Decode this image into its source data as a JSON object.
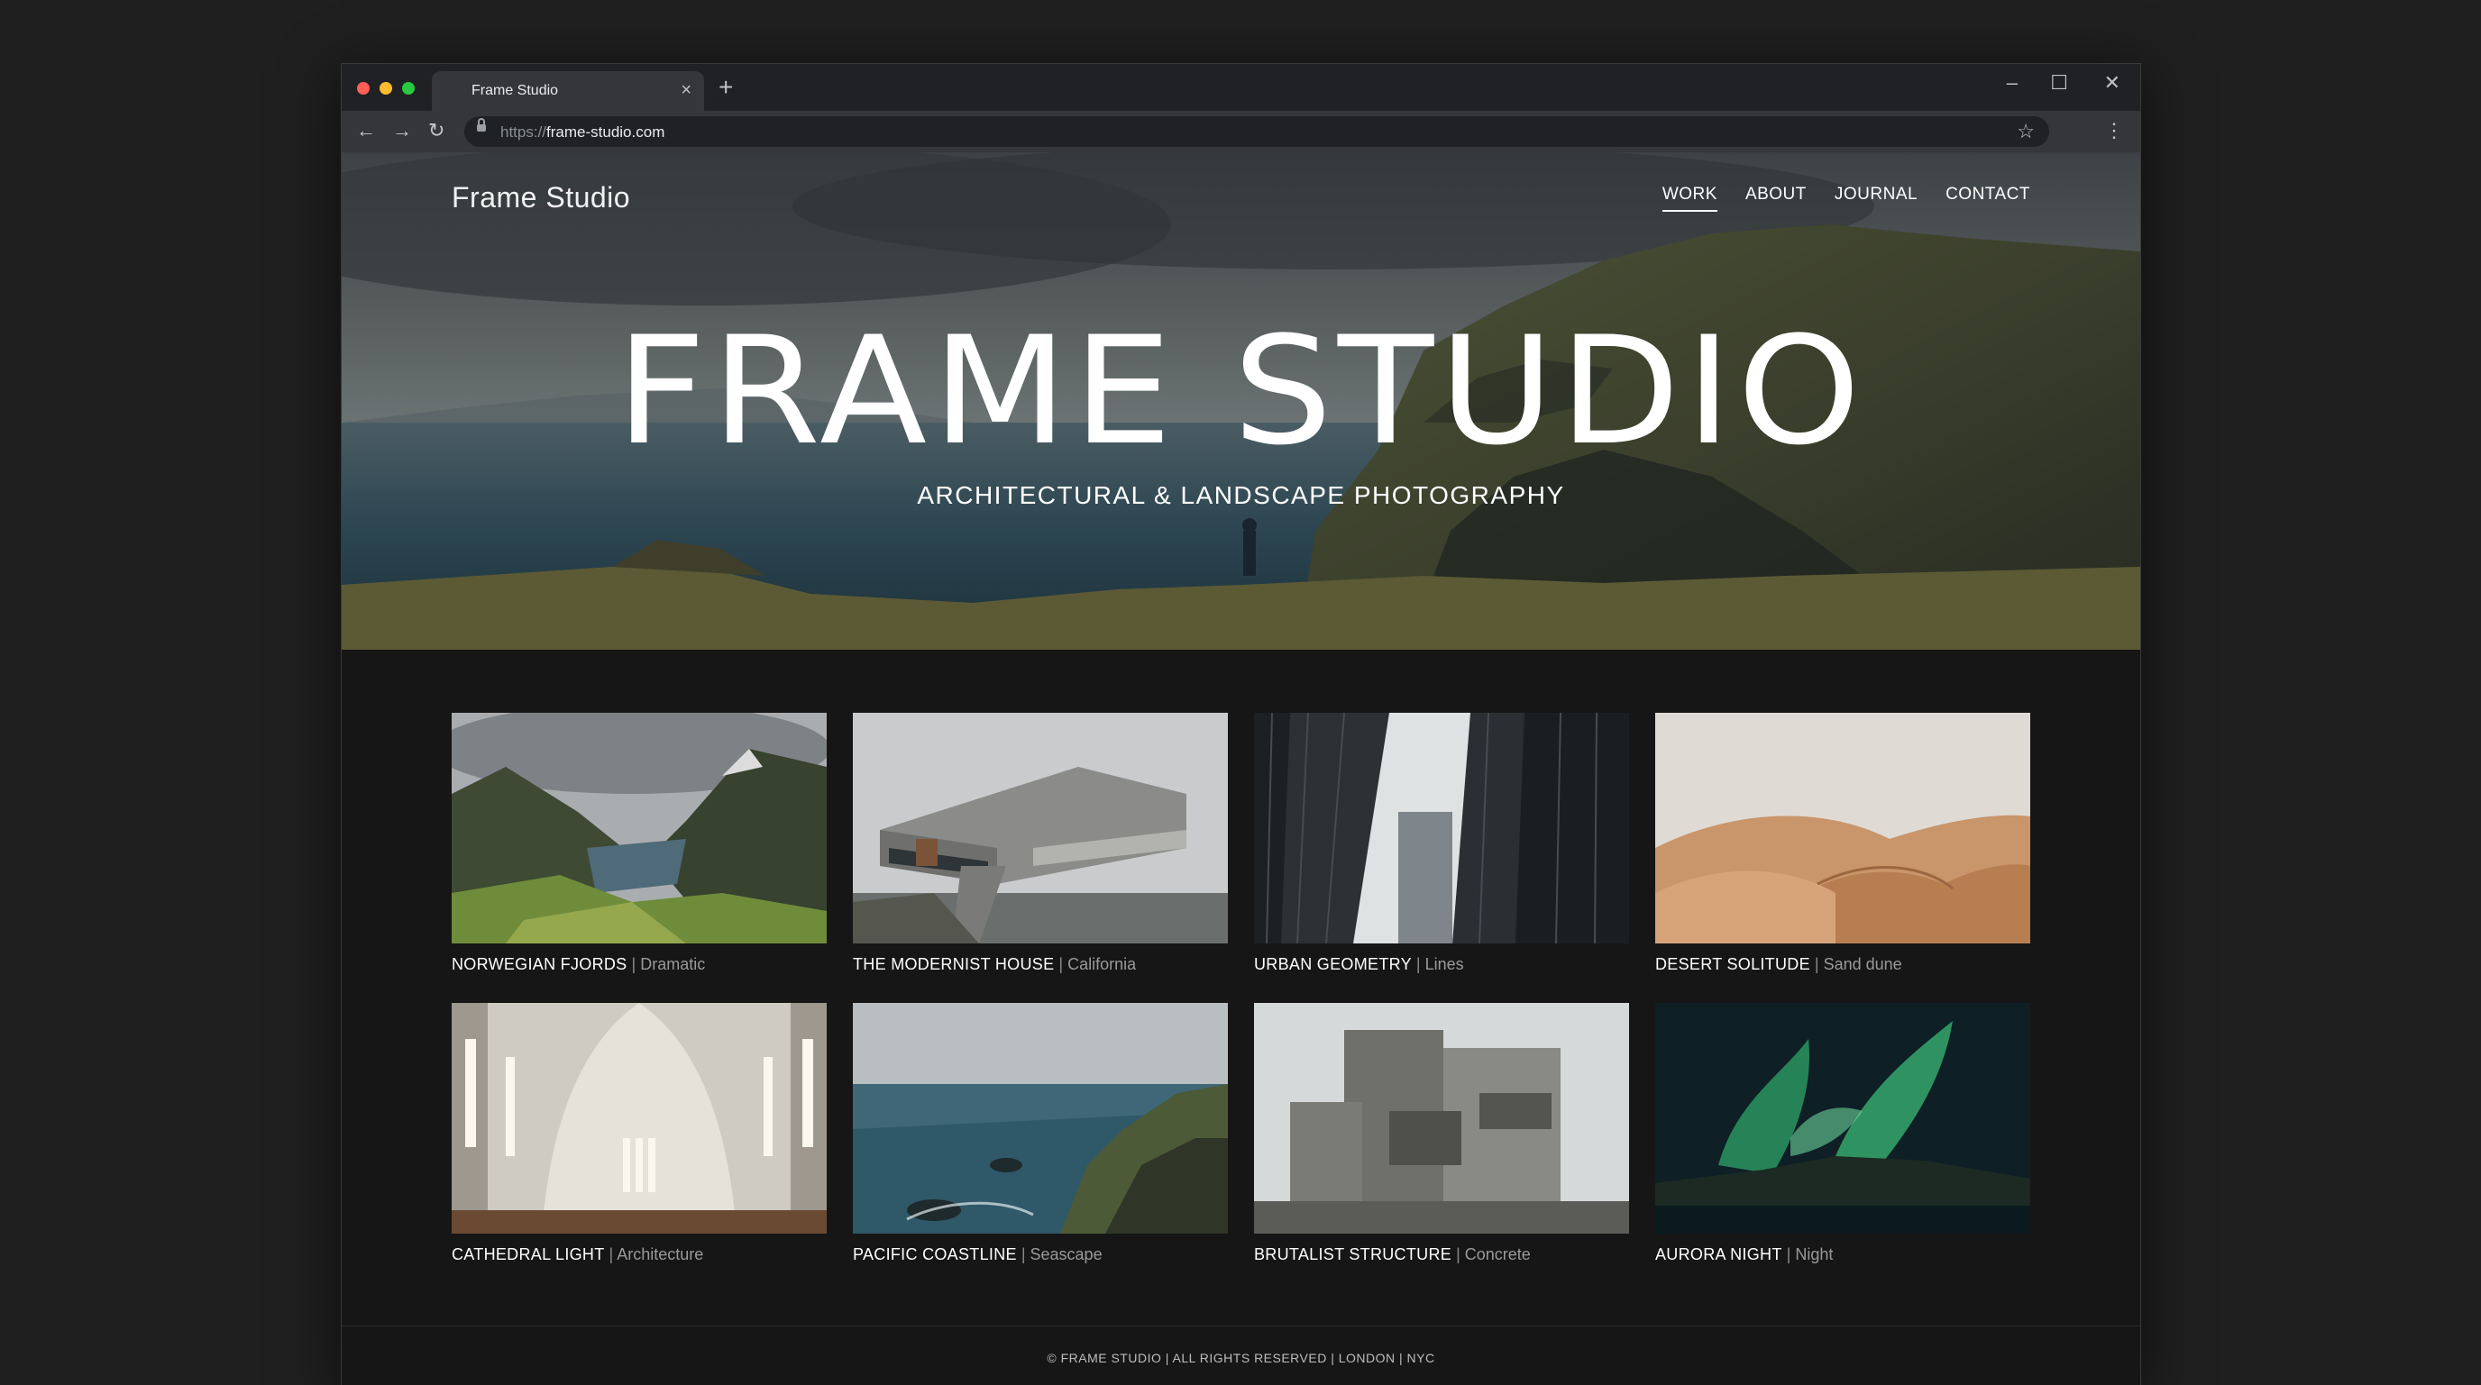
{
  "browser": {
    "tab_title": "Frame Studio",
    "tab_close": "×",
    "new_tab": "+",
    "url_scheme": "https://",
    "url_host": "frame-studio.com",
    "icons": {
      "back": "←",
      "forward": "→",
      "reload": "↻",
      "star": "☆",
      "menu": "⋮",
      "minimize": "–",
      "maximize": "☐",
      "close": "✕"
    }
  },
  "header": {
    "logo": "Frame Studio",
    "nav": [
      "WORK",
      "ABOUT",
      "JOURNAL",
      "CONTACT"
    ],
    "active_nav": "WORK"
  },
  "hero": {
    "title": "FRAME STUDIO",
    "subtitle": "ARCHITECTURAL & LANDSCAPE PHOTOGRAPHY"
  },
  "gallery": [
    {
      "title": "NORWEGIAN FJORDS",
      "category": "Dramatic",
      "image": "fjord-landscape"
    },
    {
      "title": "THE MODERNIST HOUSE",
      "category": "California",
      "image": "modernist-house"
    },
    {
      "title": "URBAN GEOMETRY",
      "category": "Lines",
      "image": "skyscrapers"
    },
    {
      "title": "DESERT SOLITUDE",
      "category": "Sand dune",
      "image": "sand-dunes"
    },
    {
      "title": "CATHEDRAL LIGHT",
      "category": "Architecture",
      "image": "cathedral-interior"
    },
    {
      "title": "PACIFIC COASTLINE",
      "category": "Seascape",
      "image": "coastal-cliffs"
    },
    {
      "title": "BRUTALIST STRUCTURE",
      "category": "Concrete",
      "image": "brutalist-building"
    },
    {
      "title": "AURORA NIGHT",
      "category": "Night",
      "image": "aurora-borealis"
    }
  ],
  "caption_separator": "|",
  "footer": "© FRAME STUDIO | ALL RIGHTS RESERVED | LONDON | NYC",
  "colors": {
    "page_background": "#1f1f1f",
    "site_background": "#161616",
    "text_primary": "#ffffff",
    "text_muted": "#9a9a9a"
  }
}
